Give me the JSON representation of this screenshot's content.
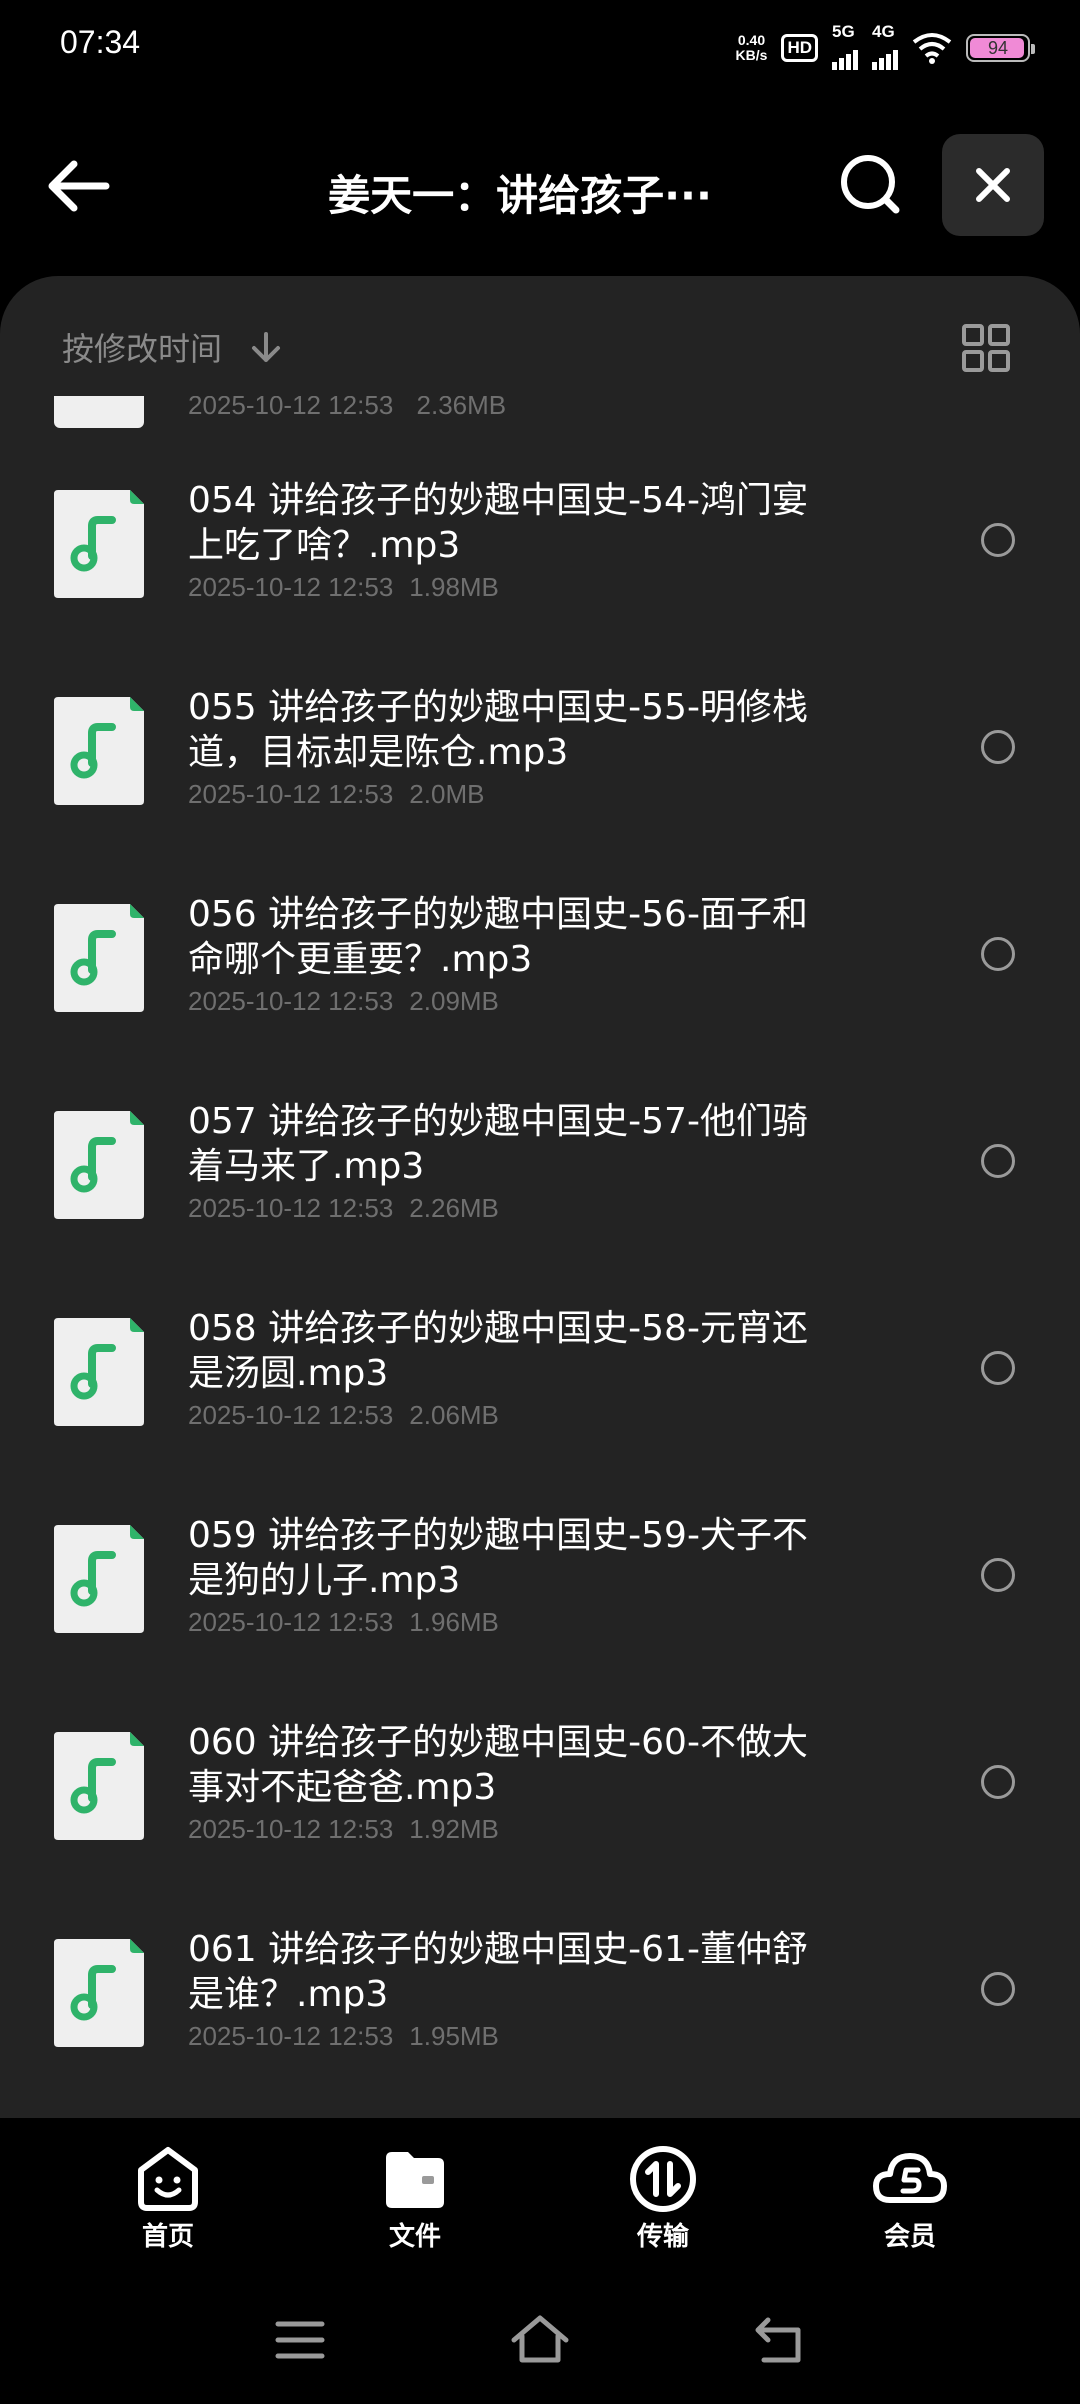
{
  "status_bar": {
    "time": "07:34",
    "net_speed_value": "0.40",
    "net_speed_unit": "KB/s",
    "hd_label": "HD",
    "net1": "5G",
    "net2": "4G",
    "battery": "94",
    "battery_color": "#f08ad6"
  },
  "header": {
    "title": "姜天一：讲给孩子···",
    "back_icon": "arrow-left-icon",
    "search_icon": "search-icon",
    "close_icon": "close-icon"
  },
  "sort": {
    "label": "按修改时间",
    "direction_icon": "arrow-down-icon",
    "view_icon": "grid-view-icon"
  },
  "partial_item": {
    "date": "2025-10-12 12:53",
    "size": "2.36MB"
  },
  "files": [
    {
      "line1": "054 讲给孩子的妙趣中国史-54-鸿门宴",
      "line2": "上吃了啥？.mp3",
      "date": "2025-10-12 12:53",
      "size": "1.98MB"
    },
    {
      "line1": "055 讲给孩子的妙趣中国史-55-明修栈",
      "line2": "道，目标却是陈仓.mp3",
      "date": "2025-10-12 12:53",
      "size": "2.0MB"
    },
    {
      "line1": "056 讲给孩子的妙趣中国史-56-面子和",
      "line2": "命哪个更重要？.mp3",
      "date": "2025-10-12 12:53",
      "size": "2.09MB"
    },
    {
      "line1": "057 讲给孩子的妙趣中国史-57-他们骑",
      "line2": "着马来了.mp3",
      "date": "2025-10-12 12:53",
      "size": "2.26MB"
    },
    {
      "line1": "058 讲给孩子的妙趣中国史-58-元宵还",
      "line2": "是汤圆.mp3",
      "date": "2025-10-12 12:53",
      "size": "2.06MB"
    },
    {
      "line1": "059 讲给孩子的妙趣中国史-59-犬子不",
      "line2": "是狗的儿子.mp3",
      "date": "2025-10-12 12:53",
      "size": "1.96MB"
    },
    {
      "line1": "060 讲给孩子的妙趣中国史-60-不做大",
      "line2": "事对不起爸爸.mp3",
      "date": "2025-10-12 12:53",
      "size": "1.92MB"
    },
    {
      "line1": "061 讲给孩子的妙趣中国史-61-董仲舒",
      "line2": "是谁？.mp3",
      "date": "2025-10-12 12:53",
      "size": "1.95MB"
    }
  ],
  "tabs": [
    {
      "label": "首页",
      "icon": "home-face-icon"
    },
    {
      "label": "文件",
      "icon": "folder-icon"
    },
    {
      "label": "传输",
      "icon": "transfer-icon"
    },
    {
      "label": "会员",
      "icon": "vip-cloud-icon"
    }
  ],
  "colors": {
    "accent_green": "#2fb36a",
    "panel_bg": "#232323",
    "page_bg": "#000000"
  }
}
